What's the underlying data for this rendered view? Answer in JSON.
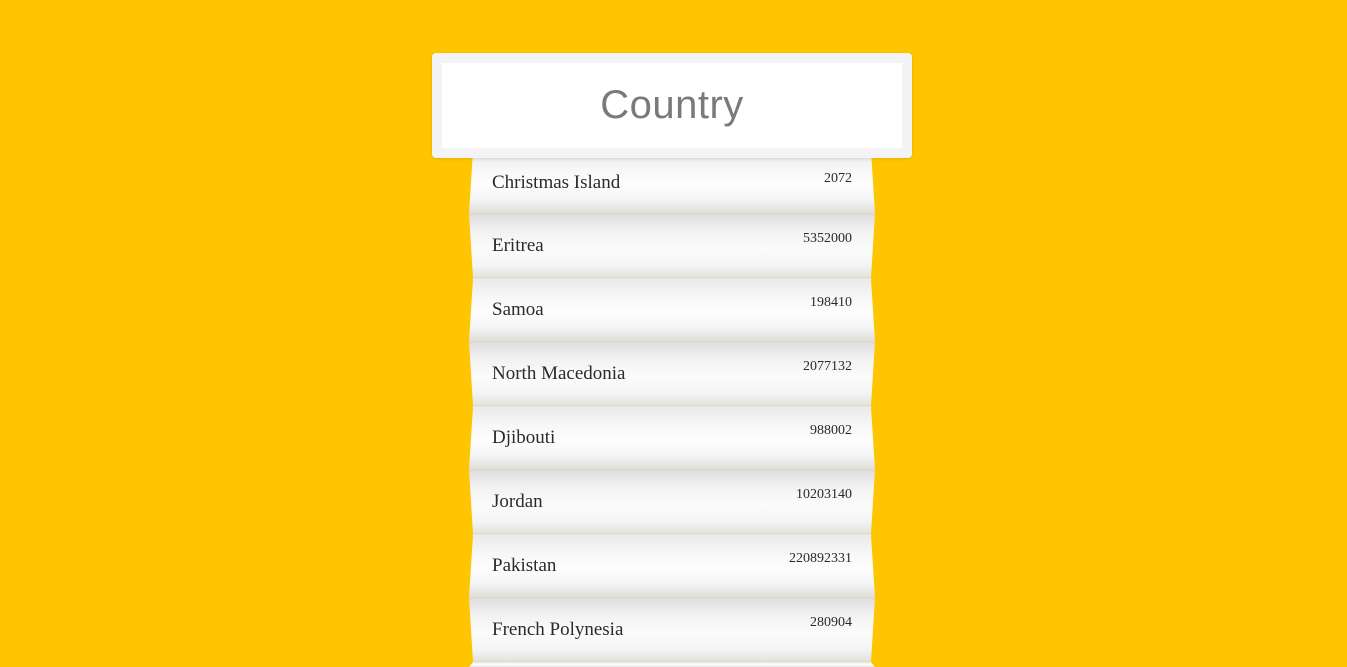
{
  "header": {
    "title": "Country"
  },
  "rows": [
    {
      "name": "Christmas Island",
      "value": "2072"
    },
    {
      "name": "Eritrea",
      "value": "5352000"
    },
    {
      "name": "Samoa",
      "value": "198410"
    },
    {
      "name": "North Macedonia",
      "value": "2077132"
    },
    {
      "name": "Djibouti",
      "value": "988002"
    },
    {
      "name": "Jordan",
      "value": "10203140"
    },
    {
      "name": "Pakistan",
      "value": "220892331"
    },
    {
      "name": "French Polynesia",
      "value": "280904"
    }
  ],
  "colors": {
    "background": "#ffc600",
    "header_text": "#7a7a7a",
    "row_text": "#2a2a2a"
  }
}
